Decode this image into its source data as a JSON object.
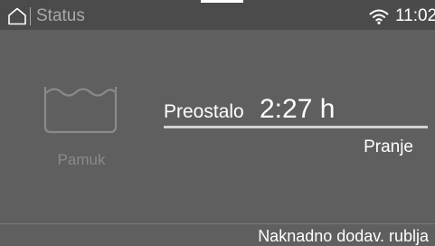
{
  "status_bar": {
    "title": "Status",
    "time": "11:02",
    "icons": [
      "home-icon",
      "wifi-icon"
    ]
  },
  "program": {
    "icon": "washtub-icon",
    "name": "Pamuk"
  },
  "remaining": {
    "label": "Preostalo",
    "time": "2:27 h",
    "progress": 1.0
  },
  "phase": "Pranje",
  "bottom_action": "Naknadno dodav. rublja",
  "colors": {
    "background": "#5f5f5f",
    "status_bar": "#4b4b4b",
    "muted_text": "#8a8a8a",
    "progress": "#d2d2d2"
  }
}
